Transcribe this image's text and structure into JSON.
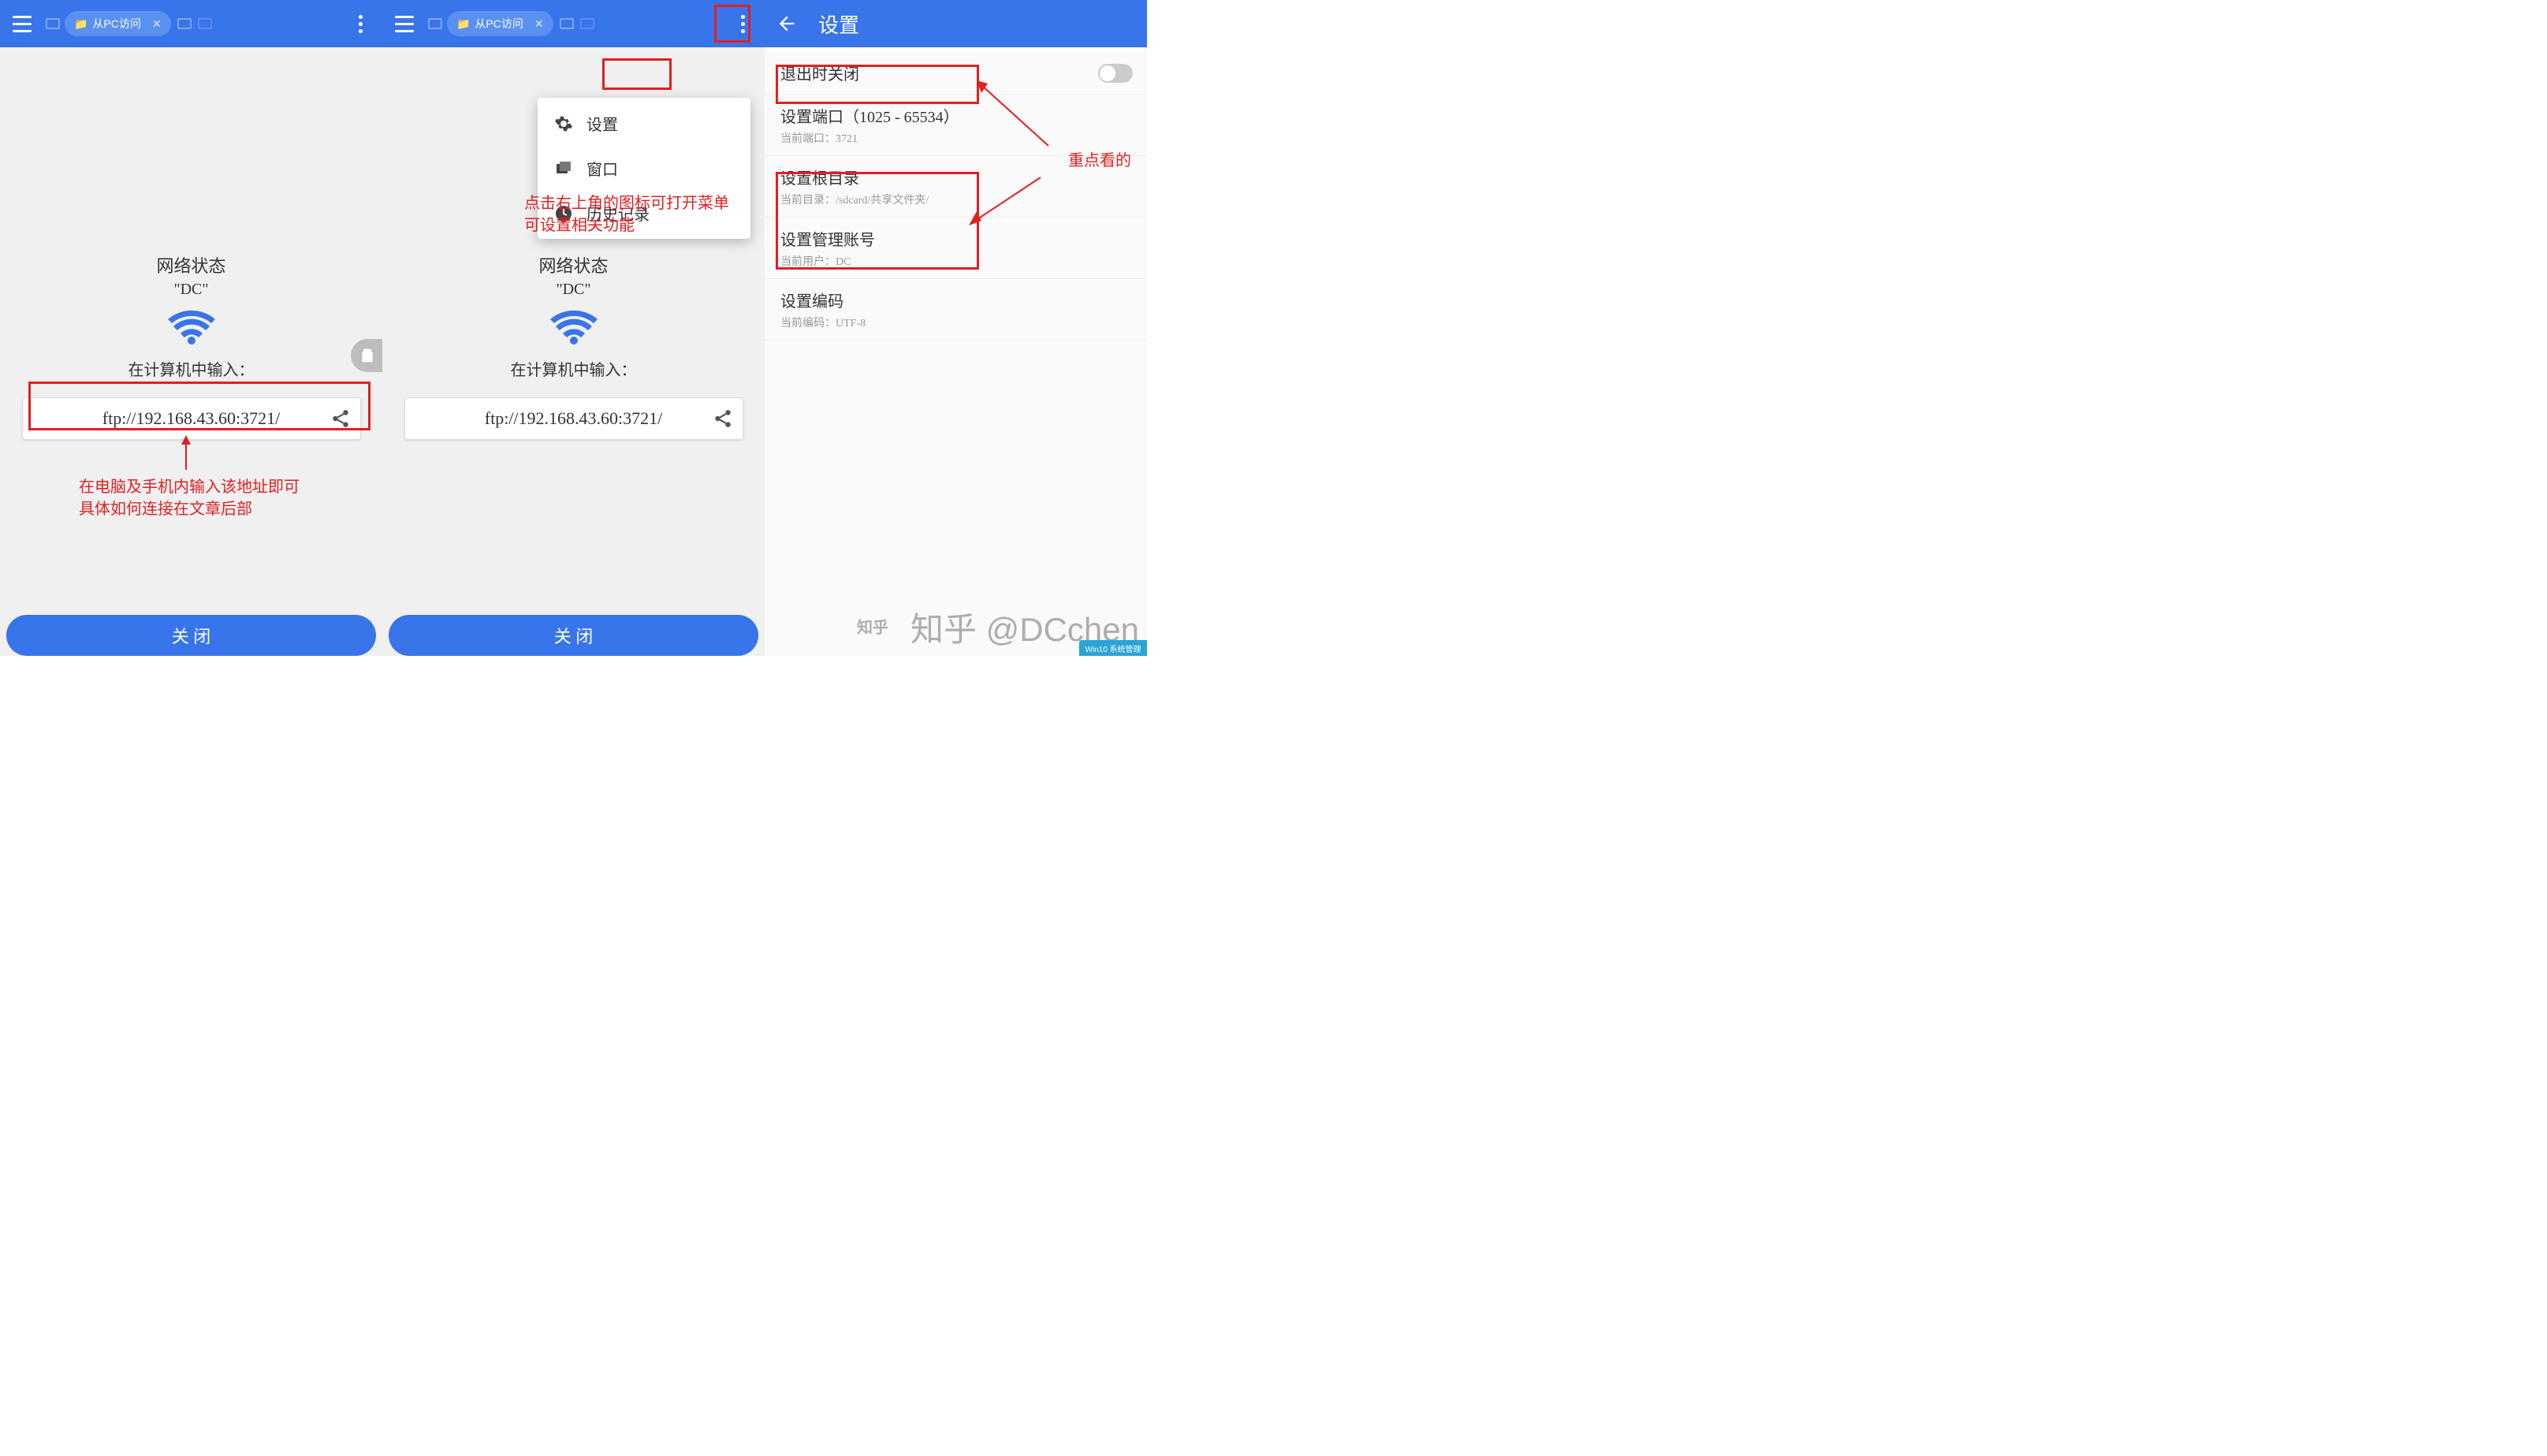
{
  "colors": {
    "accent": "#3875eb",
    "annotate": "#e02020"
  },
  "common": {
    "tab_label": "从PC访问",
    "net_state": "网络状态",
    "ssid": "\"DC\"",
    "input_prompt": "在计算机中输入：",
    "ftp_addr": "ftp://192.168.43.60:3721/",
    "close_btn": "关  闭"
  },
  "menu": {
    "settings": "设置",
    "window": "窗口",
    "history": "历史记录"
  },
  "settings": {
    "title": "设置",
    "items": [
      {
        "t": "退出时关闭",
        "sub": "",
        "toggle": true
      },
      {
        "t": "设置端口（1025 - 65534）",
        "sub": "当前端口：3721"
      },
      {
        "t": "设置根目录",
        "sub": "当前目录：/sdcard/共享文件夹/"
      },
      {
        "t": "设置管理账号",
        "sub": "当前用户：DC"
      },
      {
        "t": "设置编码",
        "sub": "当前编码：UTF-8"
      }
    ]
  },
  "annotations": {
    "a1": "在电脑及手机内输入该地址即可\n具体如何连接在文章后部",
    "a2": "点击右上角的图标可打开菜单\n可设置相关功能",
    "a3": "重点看的"
  },
  "watermark": "知乎 @DCchen",
  "corner": "Win10 系统管理"
}
